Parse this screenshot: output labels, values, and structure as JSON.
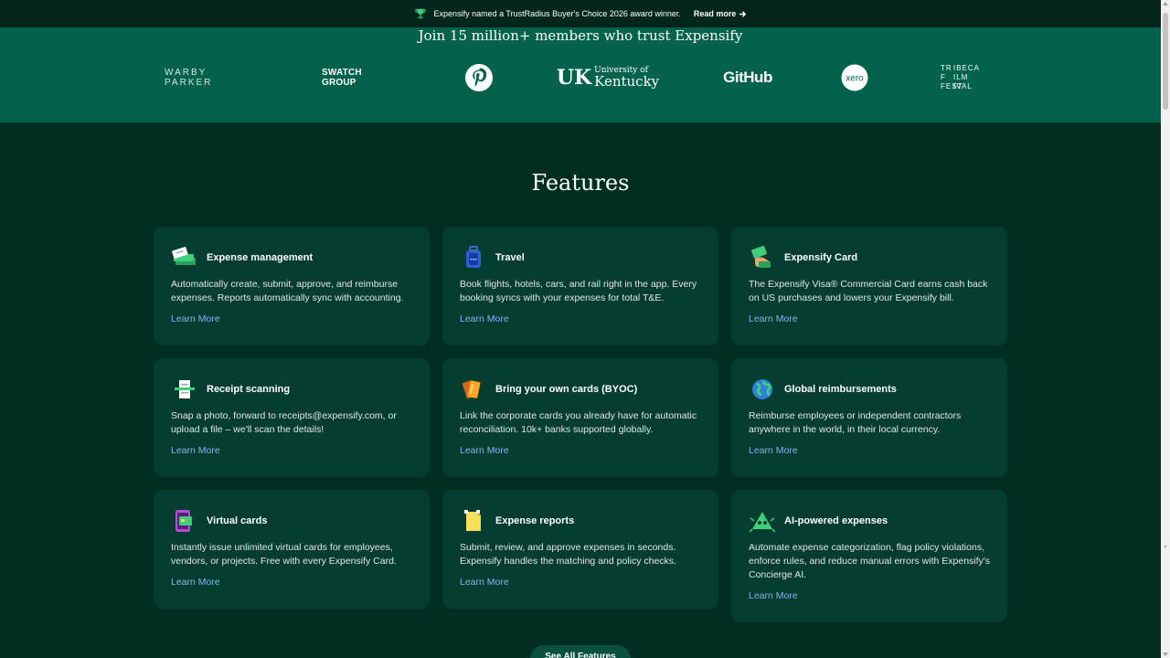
{
  "announcement": {
    "text": "Expensify named a TrustRadius Buyer's Choice 2026 award winner.",
    "link_label": "Read more",
    "icon": "trophy-icon",
    "icon_color": "#3fcf7a"
  },
  "hero": {
    "title": "Join 15 million+ members who trust Expensify",
    "logos": {
      "warby": "WARBY PARKER",
      "swatch": "SWATCH GROUP",
      "pinterest": "pinterest-logo",
      "uk_small": "University of",
      "uk_big": "Kentucky",
      "uk_mark": "UK",
      "github": "GitHub",
      "xero": "xero",
      "tribeca": [
        "TR",
        "IBECA",
        "F",
        "ILM",
        "FEST",
        "IVAL"
      ]
    }
  },
  "features": {
    "title": "Features",
    "link_label": "Learn More",
    "cards": [
      {
        "icon": "expense-stack-icon",
        "title": "Expense management",
        "desc": "Automatically create, submit, approve, and reimburse expenses. Reports automatically sync with accounting."
      },
      {
        "icon": "luggage-icon",
        "title": "Travel",
        "desc": "Book flights, hotels, cars, and rail right in the app. Every booking syncs with your expenses for total T&E."
      },
      {
        "icon": "card-hand-icon",
        "title": "Expensify Card",
        "desc": "The Expensify Visa® Commercial Card earns cash back on US purchases and lowers your Expensify bill."
      },
      {
        "icon": "receipt-scanner-icon",
        "title": "Receipt scanning",
        "desc": "Snap a photo, forward to receipts@expensify.com, or upload a file – we'll scan the details!"
      },
      {
        "icon": "cards-stack-icon",
        "title": "Bring your own cards (BYOC)",
        "desc": "Link the corporate cards you already have for automatic reconciliation. 10k+ banks supported globally."
      },
      {
        "icon": "globe-icon",
        "title": "Global reimbursements",
        "desc": "Reimburse employees or independent contractors anywhere in the world, in their local currency."
      },
      {
        "icon": "virtual-card-icon",
        "title": "Virtual cards",
        "desc": "Instantly issue unlimited virtual cards for employees, vendors, or projects. Free with every Expensify Card."
      },
      {
        "icon": "report-icon",
        "title": "Expense reports",
        "desc": "Submit, review, and approve expenses in seconds. Expensify handles the matching and policy checks."
      },
      {
        "icon": "ai-robot-icon",
        "title": "AI-powered expenses",
        "desc": "Automate expense categorization, flag policy violations, enforce rules, and reduce manual errors with Expensify's Concierge AI."
      }
    ]
  },
  "see_all_label": "See All Features"
}
